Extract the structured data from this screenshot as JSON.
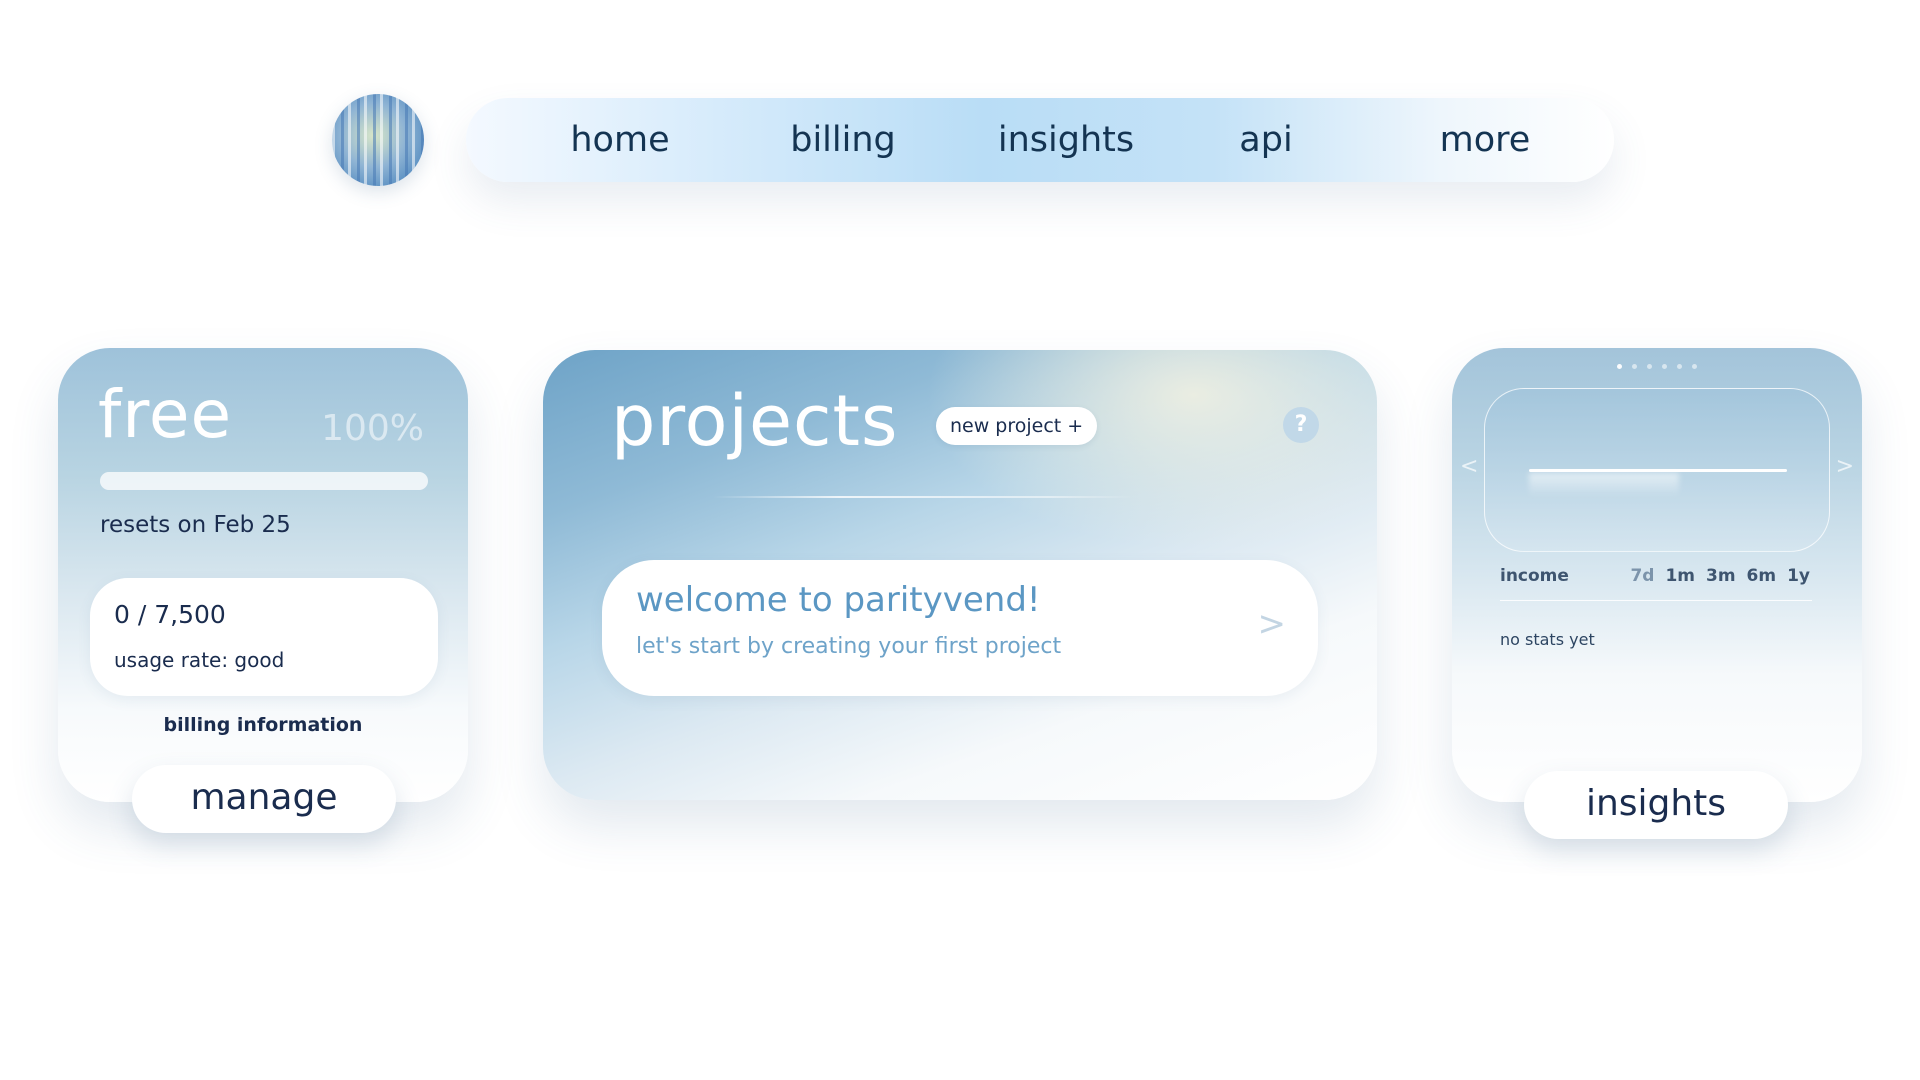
{
  "nav": {
    "avatar_icon": "user-avatar",
    "items": [
      {
        "label": "home"
      },
      {
        "label": "billing"
      },
      {
        "label": "insights"
      },
      {
        "label": "api"
      },
      {
        "label": "more"
      }
    ]
  },
  "plan": {
    "name": "free",
    "percent_label": "100%",
    "bar_fill_fraction": 1.0,
    "reset_text": "resets on Feb 25",
    "usage_count": "0 / 7,500",
    "usage_rate": "usage rate: good",
    "billing_label": "billing information",
    "manage_label": "manage"
  },
  "projects": {
    "title": "projects",
    "new_project_label": "new project  +",
    "help_icon": "?",
    "welcome_title": "welcome to parityvend!",
    "welcome_subtitle": "let's start by creating your first project",
    "welcome_arrow": ">"
  },
  "insights": {
    "page_dots": 6,
    "active_dot": 0,
    "arrow_left": "<",
    "arrow_right": ">",
    "metric_label": "income",
    "ranges": [
      "7d",
      "1m",
      "3m",
      "6m",
      "1y"
    ],
    "active_range": "7d",
    "empty_text": "no stats yet",
    "button_label": "insights"
  },
  "colors": {
    "accent": "#5b97c3",
    "text_dark": "#1a2c4e",
    "nav_gradient_mid": "#b9ddf6"
  }
}
